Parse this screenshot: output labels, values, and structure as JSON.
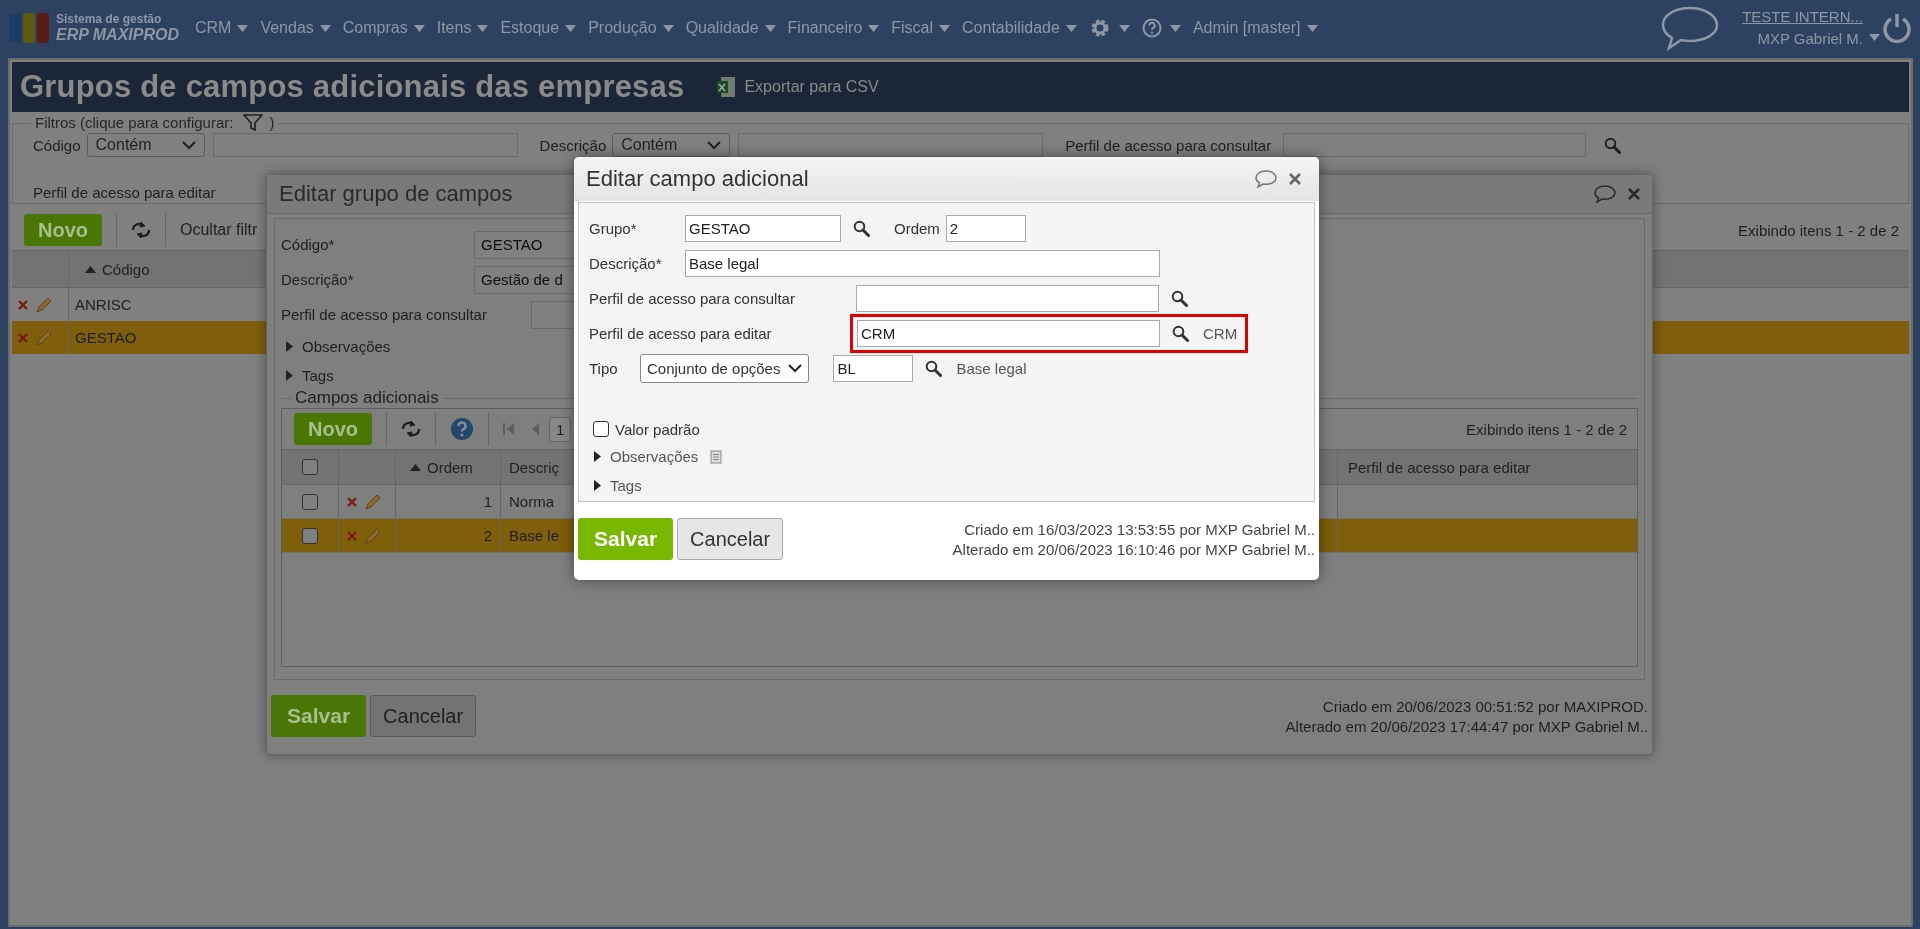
{
  "nav": {
    "brand_line1": "Sistema de gestão",
    "brand_line2": "ERP MAXIPROD",
    "menus": [
      {
        "kind": "text",
        "label": "CRM"
      },
      {
        "kind": "text",
        "label": "Vendas"
      },
      {
        "kind": "text",
        "label": "Compras"
      },
      {
        "kind": "text",
        "label": "Itens"
      },
      {
        "kind": "text",
        "label": "Estoque"
      },
      {
        "kind": "text",
        "label": "Produção"
      },
      {
        "kind": "text",
        "label": "Qualidade"
      },
      {
        "kind": "text",
        "label": "Financeiro"
      },
      {
        "kind": "text",
        "label": "Fiscal"
      },
      {
        "kind": "text",
        "label": "Contabilidade"
      },
      {
        "kind": "gear"
      },
      {
        "kind": "help"
      },
      {
        "kind": "text",
        "label": "Admin [master]"
      }
    ],
    "company": "TESTE INTERN...",
    "user": "MXP Gabriel M."
  },
  "page": {
    "title": "Grupos de campos adicionais das empresas",
    "export": "Exportar para CSV"
  },
  "filters": {
    "legend": "Filtros (clique para configurar:",
    "legend_end": ")",
    "rows": [
      [
        {
          "kind": "operator",
          "label": "Código",
          "operator": "Contém"
        },
        {
          "kind": "operator",
          "label": "Descrição",
          "operator": "Contém"
        },
        {
          "kind": "lookup",
          "label": "Perfil de acesso para consultar"
        }
      ],
      [
        {
          "kind": "label",
          "label": "Perfil de acesso para editar"
        }
      ]
    ]
  },
  "grid": {
    "new": "Novo",
    "hide_filters": "Ocultar filtr",
    "paging": "Exibindo itens 1 - 2 de 2",
    "column": "Código",
    "rows": [
      {
        "code": "ANRISC",
        "selected": false
      },
      {
        "code": "GESTAO",
        "selected": true
      }
    ]
  },
  "group_dialog": {
    "title": "Editar grupo de campos",
    "code": {
      "label": "Código*",
      "value": "GESTAO"
    },
    "description": {
      "label": "Descrição*",
      "value": "Gestão de d"
    },
    "view_profile": {
      "label": "Perfil de acesso para consultar"
    },
    "sections": [
      {
        "label": "Observações",
        "expanded": false
      },
      {
        "label": "Tags",
        "expanded": false
      }
    ],
    "fields_legend": "Campos adicionais",
    "fields_grid": {
      "new": "Novo",
      "page": "1",
      "paging": "Exibindo itens 1 - 2 de 2",
      "all_checked": false,
      "columns": [
        "Ordem",
        "Descriç",
        "Perfil de acesso para editar"
      ],
      "rows": [
        {
          "checked": false,
          "order": "1",
          "description": "Norma",
          "selected": false
        },
        {
          "checked": false,
          "order": "2",
          "description": "Base le",
          "selected": true
        }
      ]
    },
    "save": "Salvar",
    "cancel": "Cancelar",
    "audit": [
      "Criado em 20/06/2023 00:51:52 por MAXIPROD.",
      "Alterado em 20/06/2023 17:44:47 por MXP Gabriel M.."
    ]
  },
  "field_dialog": {
    "title": "Editar campo adicional",
    "group": {
      "label": "Grupo*",
      "value": "GESTAO"
    },
    "order": {
      "label": "Ordem",
      "value": "2"
    },
    "description": {
      "label": "Descrição*",
      "value": "Base legal"
    },
    "view_profile": {
      "label": "Perfil de acesso para consultar"
    },
    "edit_profile": {
      "label": "Perfil de acesso para editar",
      "value": "CRM",
      "resolved": "CRM",
      "highlighted": true
    },
    "type": {
      "label": "Tipo",
      "value": "Conjunto de opções",
      "option_code": "BL",
      "option_name": "Base legal"
    },
    "default_value": {
      "label": "Valor padrão",
      "checked": false
    },
    "sections": [
      {
        "label": "Observações",
        "expanded": false,
        "has_note": true
      },
      {
        "label": "Tags",
        "expanded": false,
        "has_note": false
      }
    ],
    "save": "Salvar",
    "cancel": "Cancelar",
    "audit": [
      "Criado em 16/03/2023 13:53:55 por MXP Gabriel M..",
      "Alterado em 20/06/2023 16:10:46 por MXP Gabriel M.."
    ]
  }
}
